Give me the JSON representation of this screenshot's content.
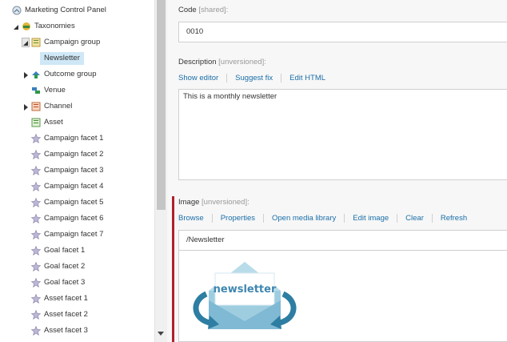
{
  "tree": {
    "items": [
      {
        "label": "Marketing Control Panel",
        "icon": "control-panel-icon",
        "expander": "none"
      },
      {
        "label": "Taxonomies",
        "icon": "taxonomies-icon",
        "expander": "expanded"
      },
      {
        "label": "Campaign group",
        "icon": "campaign-group-icon",
        "expander": "expanded"
      },
      {
        "label": "Newsletter",
        "icon": "star-icon",
        "expander": "none",
        "selected": true
      },
      {
        "label": "Outcome group",
        "icon": "outcome-group-icon",
        "expander": "collapsed"
      },
      {
        "label": "Venue",
        "icon": "venue-icon",
        "expander": "none"
      },
      {
        "label": "Channel",
        "icon": "channel-icon",
        "expander": "collapsed"
      },
      {
        "label": "Asset",
        "icon": "asset-icon",
        "expander": "none"
      },
      {
        "label": "Campaign facet 1",
        "icon": "facet-star-icon",
        "expander": "none"
      },
      {
        "label": "Campaign facet 2",
        "icon": "facet-star-icon",
        "expander": "none"
      },
      {
        "label": "Campaign facet 3",
        "icon": "facet-star-icon",
        "expander": "none"
      },
      {
        "label": "Campaign facet 4",
        "icon": "facet-star-icon",
        "expander": "none"
      },
      {
        "label": "Campaign facet 5",
        "icon": "facet-star-icon",
        "expander": "none"
      },
      {
        "label": "Campaign facet 6",
        "icon": "facet-star-icon",
        "expander": "none"
      },
      {
        "label": "Campaign facet 7",
        "icon": "facet-star-icon",
        "expander": "none"
      },
      {
        "label": "Goal facet 1",
        "icon": "facet-star-icon",
        "expander": "none"
      },
      {
        "label": "Goal facet 2",
        "icon": "facet-star-icon",
        "expander": "none"
      },
      {
        "label": "Goal facet 3",
        "icon": "facet-star-icon",
        "expander": "none"
      },
      {
        "label": "Asset facet 1",
        "icon": "facet-star-icon",
        "expander": "none"
      },
      {
        "label": "Asset facet 2",
        "icon": "facet-star-icon",
        "expander": "none"
      },
      {
        "label": "Asset facet 3",
        "icon": "facet-star-icon",
        "expander": "none"
      }
    ]
  },
  "code": {
    "label": "Code",
    "qualifier": "[shared]:",
    "value": "0010"
  },
  "description": {
    "label": "Description",
    "qualifier": "[unversioned]:",
    "toolbar": [
      "Show editor",
      "Suggest fix",
      "Edit HTML"
    ],
    "value": "This is a monthly newsletter"
  },
  "image": {
    "label": "Image",
    "qualifier": "[unversioned]:",
    "toolbar": [
      "Browse",
      "Properties",
      "Open media library",
      "Edit image",
      "Clear",
      "Refresh"
    ],
    "path": "/Newsletter",
    "thumbnail_text": "newsletter"
  },
  "colors": {
    "link": "#1a6ea8",
    "selected_bg": "#cfe7f6",
    "required_bar": "#b2202a"
  }
}
